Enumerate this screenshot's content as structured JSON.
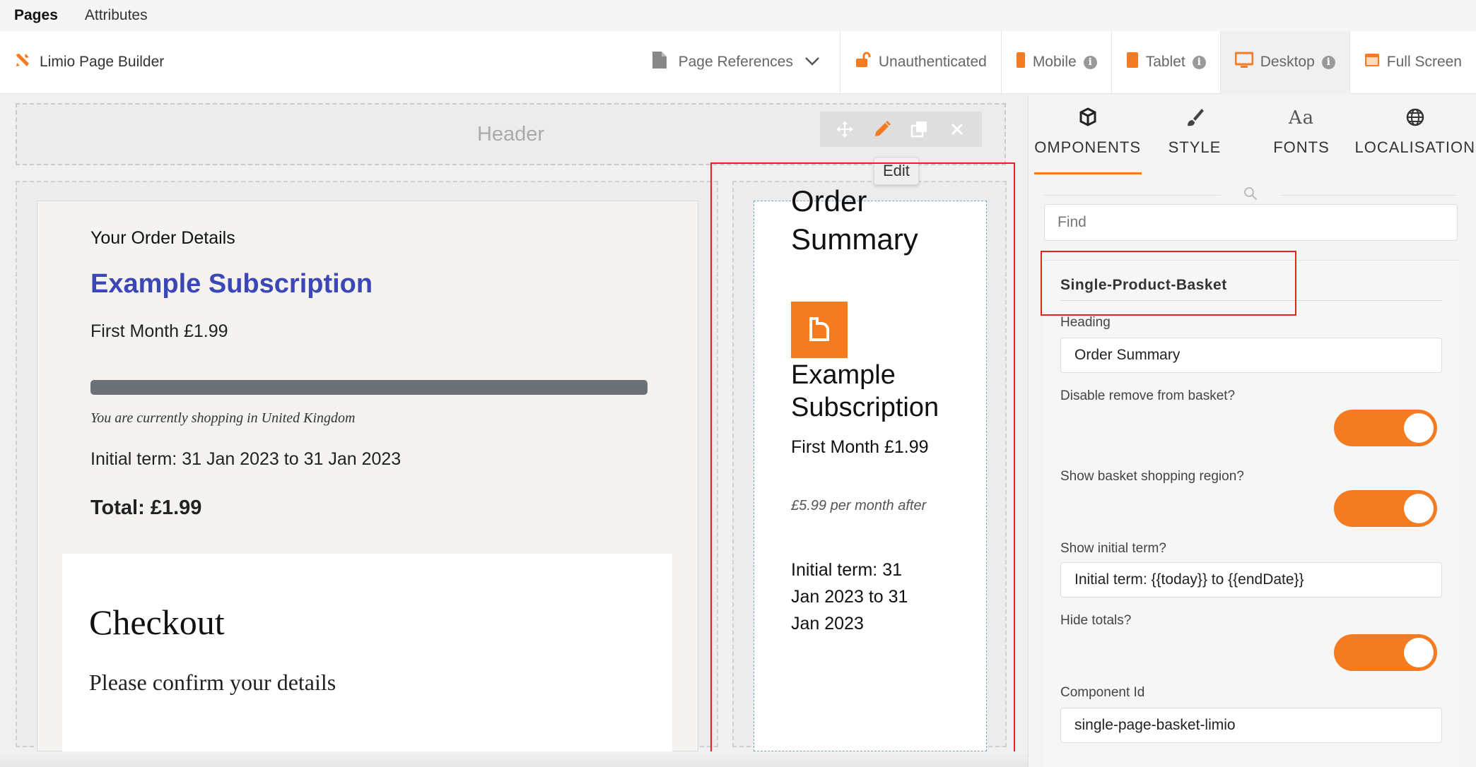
{
  "top_menu": {
    "pages": "Pages",
    "attributes": "Attributes"
  },
  "toolbar": {
    "brand": "Limio Page Builder",
    "page_references": "Page References",
    "unauthenticated": "Unauthenticated",
    "mobile": "Mobile",
    "tablet": "Tablet",
    "desktop": "Desktop",
    "full_screen": "Full Screen",
    "info_glyph": "i"
  },
  "canvas": {
    "header_placeholder": "Header",
    "order_details": {
      "heading": "Your Order Details",
      "title": "Example Subscription",
      "price": "First Month £1.99",
      "region": "You are currently shopping in United Kingdom",
      "term": "Initial term: 31 Jan 2023 to 31 Jan 2023",
      "total": "Total: £1.99"
    },
    "checkout": {
      "title": "Checkout",
      "subtitle": "Please confirm your details"
    },
    "order_summary": {
      "title": "Order Summary",
      "product_name": "Example Subscription",
      "price": "First Month £1.99",
      "after": "£5.99 per month after",
      "term": "Initial term: 31 Jan 2023 to 31 Jan 2023"
    },
    "edit_tooltip": "Edit"
  },
  "panel": {
    "tabs": [
      {
        "label": "COMPONENTS"
      },
      {
        "label": "STYLE"
      },
      {
        "label": "FONTS"
      },
      {
        "label": "LOCALISATION"
      }
    ],
    "font_icon_text": "Aa",
    "find_placeholder": "Find",
    "component": {
      "name": "Single-Product-Basket",
      "heading_label": "Heading",
      "heading_value": "Order Summary",
      "disable_remove_label": "Disable remove from basket?",
      "disable_remove_value": true,
      "show_region_label": "Show basket shopping region?",
      "show_region_value": true,
      "initial_term_label": "Show initial term?",
      "initial_term_value": "Initial term: {{today}} to {{endDate}}",
      "hide_totals_label": "Hide totals?",
      "hide_totals_value": true,
      "component_id_label": "Component Id",
      "component_id_value": "single-page-basket-limio"
    }
  },
  "colors": {
    "accent": "#f47b20",
    "title_blue": "#3b46b7",
    "highlight_red": "#e02424"
  }
}
